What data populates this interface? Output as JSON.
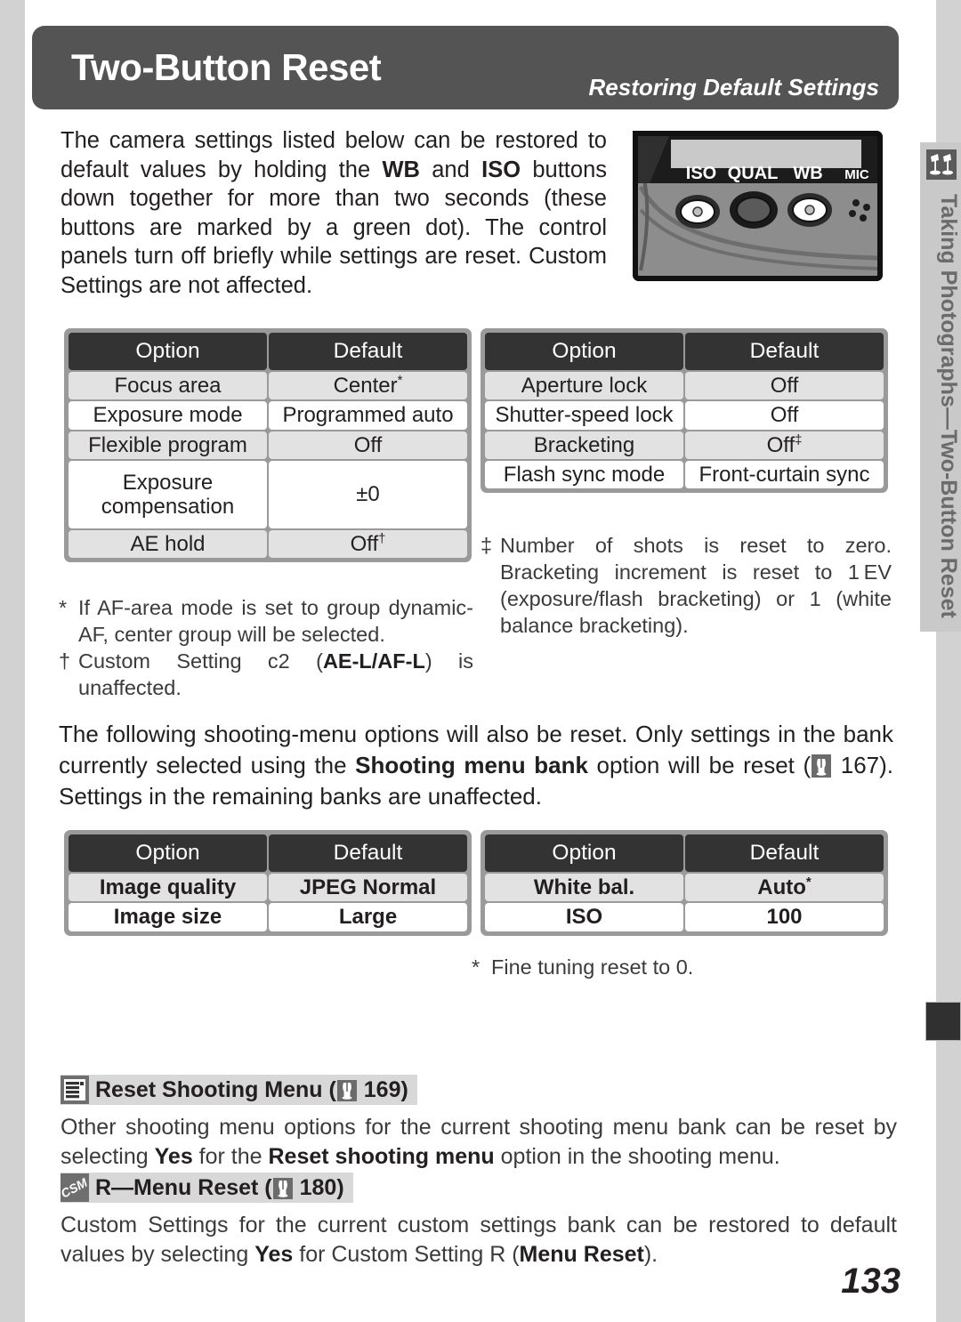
{
  "header": {
    "title": "Two-Button Reset",
    "subtitle": "Restoring Default Settings"
  },
  "intro": {
    "part1": "The camera settings listed below can be restored to default values by holding the ",
    "bold1": "WB",
    "part2": " and ",
    "bold2": "ISO",
    "part3": " buttons down together for more than two seconds (these buttons are marked by a green dot).  The control panels turn off briefly while settings are reset.  Custom Settings are not affected."
  },
  "camera_figure": {
    "labels": [
      "ISO",
      "QUAL",
      "WB",
      "MIC"
    ],
    "alt": "Camera top control panel with ISO, QUAL and WB buttons"
  },
  "side_tab": {
    "text": "Taking Photographs—Two-Button Reset",
    "icon": "studio-lights-icon"
  },
  "tables": {
    "headers": [
      "Option",
      "Default"
    ],
    "top_left": [
      {
        "option": "Focus area",
        "default": "Center",
        "default_mark": "*"
      },
      {
        "option": "Exposure mode",
        "default": "Programmed auto",
        "default_mark": ""
      },
      {
        "option": "Flexible program",
        "default": "Off",
        "default_mark": ""
      },
      {
        "option": "Exposure compensation",
        "default": "±0",
        "default_mark": ""
      },
      {
        "option": "AE hold",
        "default": "Off",
        "default_mark": "†"
      }
    ],
    "top_right": [
      {
        "option": "Aperture lock",
        "default": "Off",
        "default_mark": ""
      },
      {
        "option": "Shutter-speed lock",
        "default": "Off",
        "default_mark": ""
      },
      {
        "option": "Bracketing",
        "default": "Off",
        "default_mark": "‡"
      },
      {
        "option": "Flash sync mode",
        "default": "Front-curtain sync",
        "default_mark": ""
      }
    ],
    "bottom_left": [
      {
        "option": "Image quality",
        "default": "JPEG Normal",
        "default_mark": ""
      },
      {
        "option": "Image size",
        "default": "Large",
        "default_mark": ""
      }
    ],
    "bottom_right": [
      {
        "option": "White bal.",
        "default": "Auto",
        "default_mark": "*"
      },
      {
        "option": "ISO",
        "default": "100",
        "default_mark": ""
      }
    ]
  },
  "footnotes": {
    "left": [
      {
        "mark": "*",
        "text": "If AF-area mode is set to group dynamic-AF, center group will be selected."
      },
      {
        "mark": "†",
        "pre": "Custom Setting c2 (",
        "bold": "AE-L/AF-L",
        "post": ") is unaffected."
      }
    ],
    "right": [
      {
        "mark": "‡",
        "text": "Number of shots is reset to zero. Bracketing increment is reset to 1 EV (exposure/flash bracketing) or 1 (white balance bracketing)."
      }
    ],
    "bottom": [
      {
        "mark": "*",
        "text": "Fine tuning reset to 0."
      }
    ]
  },
  "mid_paragraph": {
    "part1": "The following shooting-menu options will also be reset.  Only settings in the bank currently selected using the ",
    "bold1": "Shooting menu bank",
    "part2": " option will be reset (",
    "pageref": "167",
    "part3": ").  Settings in the remaining banks are unaffected."
  },
  "notes": [
    {
      "badge": "menu-icon",
      "title_pre": "Reset Shooting Menu (",
      "title_page": "169",
      "title_post": ")",
      "body_part1": "Other shooting menu options for the current shooting menu bank can be reset by selecting ",
      "body_bold1": "Yes",
      "body_part2": " for the ",
      "body_bold2": "Reset shooting menu",
      "body_part3": " option in the shooting menu."
    },
    {
      "badge": "csm-icon",
      "title_pre": "R—Menu Reset (",
      "title_page": "180",
      "title_post": ")",
      "body_part1": "Custom Settings for the current custom settings bank can be restored to default values by selecting ",
      "body_bold1": "Yes",
      "body_part2": " for Custom Setting R (",
      "body_bold2": "Menu Reset",
      "body_part3": ")."
    }
  ],
  "page_number": "133",
  "colors": {
    "header_bar": "#555454",
    "table_header": "#333333",
    "row_gray": "#e2e2e2",
    "row_white": "#ffffff",
    "table_border": "#9a9a9a",
    "page_margin": "#d2d2d2",
    "side_tab": "#c9c9c9"
  }
}
